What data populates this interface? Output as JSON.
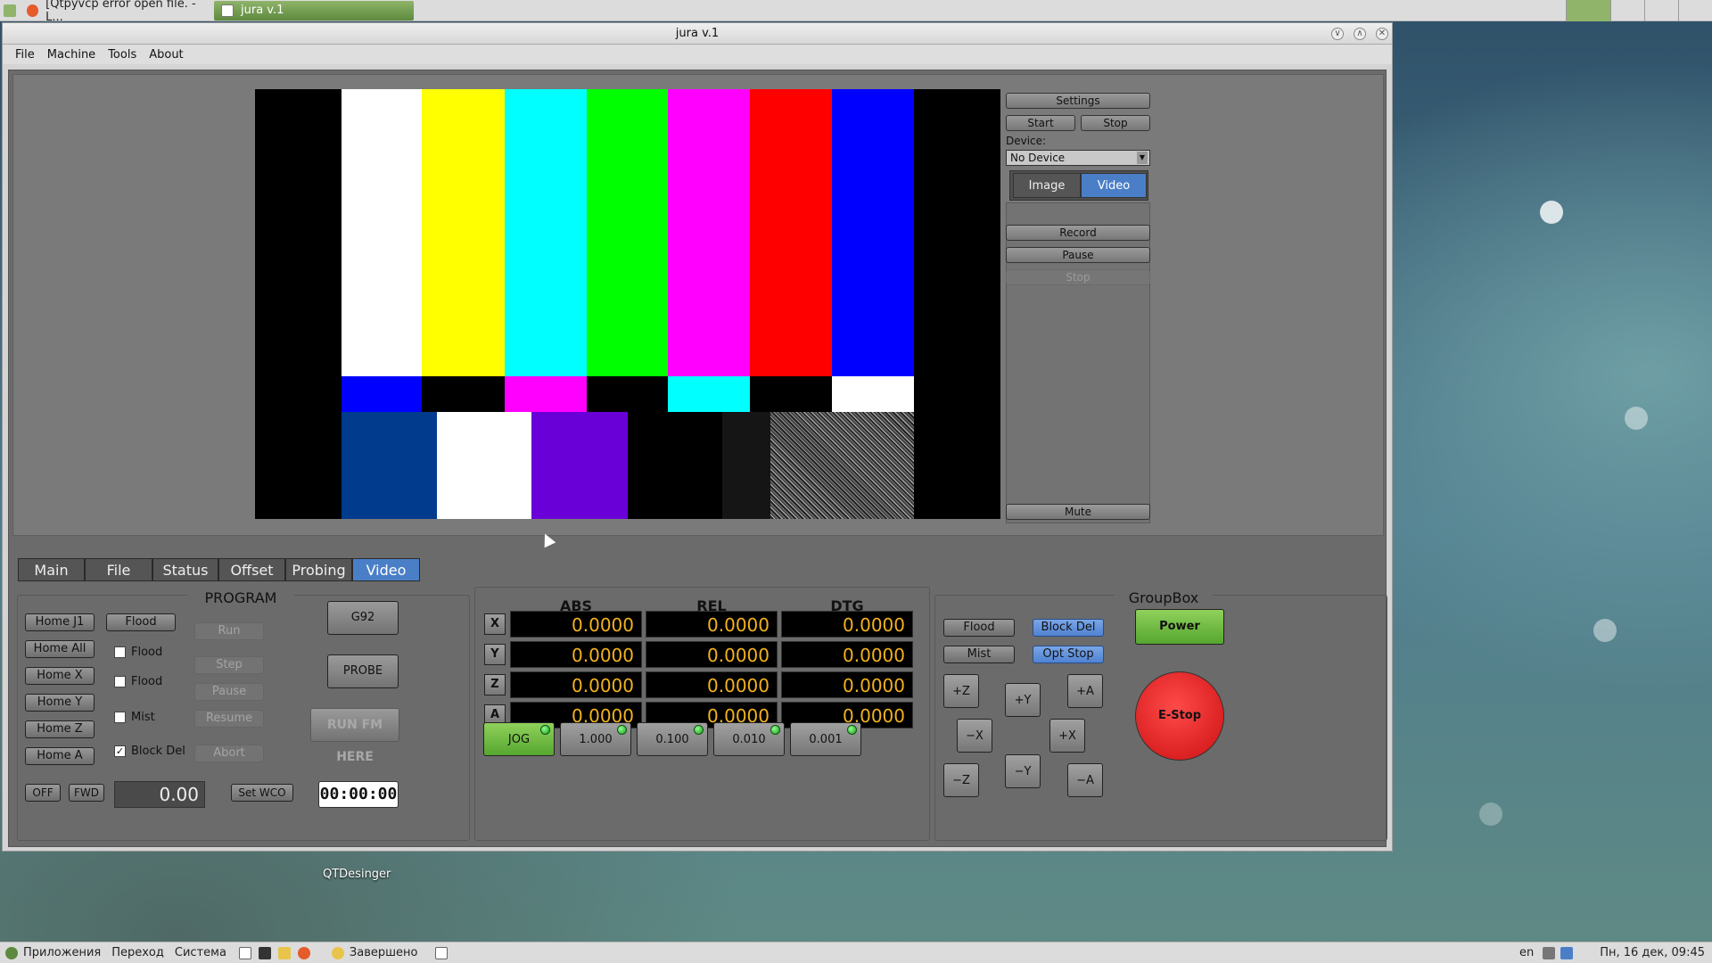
{
  "taskbar_top": {
    "tasks": [
      {
        "label": "[Qtpyvcp error open file. - L..."
      },
      {
        "label": "jura v.1"
      }
    ]
  },
  "window": {
    "title": "jura v.1"
  },
  "menu": [
    "File",
    "Machine",
    "Tools",
    "About"
  ],
  "video_panel": {
    "settings": "Settings",
    "start": "Start",
    "stop": "Stop",
    "device_label": "Device:",
    "device_value": "No Device",
    "mode": [
      "Image",
      "Video"
    ],
    "mode_selected": "Video",
    "record": "Record",
    "pause": "Pause",
    "stop2": "Stop",
    "mute": "Mute",
    "colors": {
      "accent": "#4a7fc8"
    }
  },
  "tabs": [
    {
      "label": "Main"
    },
    {
      "label": "File"
    },
    {
      "label": "Status"
    },
    {
      "label": "Offset"
    },
    {
      "label": "Probing"
    },
    {
      "label": "Video"
    }
  ],
  "tab_selected": "Video",
  "program": {
    "title": "PROGRAM",
    "home": [
      "Home J1",
      "Home All",
      "Home X",
      "Home Y",
      "Home Z",
      "Home A"
    ],
    "flood_btn": "Flood",
    "checks": [
      {
        "label": "Flood",
        "checked": false
      },
      {
        "label": "Flood",
        "checked": false
      },
      {
        "label": "Mist",
        "checked": false
      },
      {
        "label": "Block Del",
        "checked": true
      }
    ],
    "run": "Run",
    "step": "Step",
    "pause": "Pause",
    "resume": "Resume",
    "abort": "Abort",
    "g92": "G92",
    "probe": "PROBE",
    "run_from_here": "RUN FM HERE",
    "off": "OFF",
    "fwd": "FWD",
    "spindle_value": "0.00",
    "set_wco": "Set WCO",
    "timer": "00:00:00"
  },
  "dro": {
    "headers": [
      "ABS",
      "REL",
      "DTG"
    ],
    "rows": [
      {
        "axis": "X",
        "abs": "0.0000",
        "rel": "0.0000",
        "dtg": "0.0000"
      },
      {
        "axis": "Y",
        "abs": "0.0000",
        "rel": "0.0000",
        "dtg": "0.0000"
      },
      {
        "axis": "Z",
        "abs": "0.0000",
        "rel": "0.0000",
        "dtg": "0.0000"
      },
      {
        "axis": "A",
        "abs": "0.0000",
        "rel": "0.0000",
        "dtg": "0.0000"
      }
    ],
    "increments": [
      "JOG",
      "1.000",
      "0.100",
      "0.010",
      "0.001"
    ],
    "colors": {
      "value": "#f2b21e",
      "jog_active": "#6bbf3f"
    }
  },
  "groupbox": {
    "title": "GroupBox",
    "flood": "Flood",
    "block_del": "Block Del",
    "mist": "Mist",
    "opt_stop": "Opt Stop",
    "jog": {
      "pz": "+Z",
      "py": "+Y",
      "pa": "+A",
      "mx": "−X",
      "px": "+X",
      "mz": "−Z",
      "my": "−Y",
      "ma": "−A"
    },
    "power": "Power",
    "estop": "E-Stop",
    "colors": {
      "power": "#6bbf3f",
      "estop": "#e02020"
    }
  },
  "desktop": {
    "icon_label": "QTDesinger"
  },
  "taskbar_bottom": {
    "apps": "Приложения",
    "go": "Переход",
    "system": "Система",
    "task": "Завершено",
    "lang": "en",
    "clock": "Пн, 16 дек, 09:45"
  }
}
